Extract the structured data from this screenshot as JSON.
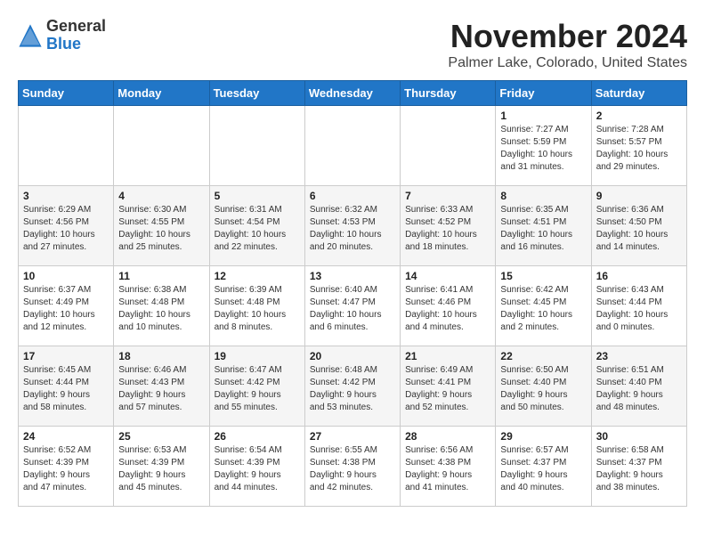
{
  "logo": {
    "general": "General",
    "blue": "Blue"
  },
  "header": {
    "month_title": "November 2024",
    "location": "Palmer Lake, Colorado, United States"
  },
  "days_of_week": [
    "Sunday",
    "Monday",
    "Tuesday",
    "Wednesday",
    "Thursday",
    "Friday",
    "Saturday"
  ],
  "weeks": [
    [
      {
        "day": "",
        "info": ""
      },
      {
        "day": "",
        "info": ""
      },
      {
        "day": "",
        "info": ""
      },
      {
        "day": "",
        "info": ""
      },
      {
        "day": "",
        "info": ""
      },
      {
        "day": "1",
        "info": "Sunrise: 7:27 AM\nSunset: 5:59 PM\nDaylight: 10 hours\nand 31 minutes."
      },
      {
        "day": "2",
        "info": "Sunrise: 7:28 AM\nSunset: 5:57 PM\nDaylight: 10 hours\nand 29 minutes."
      }
    ],
    [
      {
        "day": "3",
        "info": "Sunrise: 6:29 AM\nSunset: 4:56 PM\nDaylight: 10 hours\nand 27 minutes."
      },
      {
        "day": "4",
        "info": "Sunrise: 6:30 AM\nSunset: 4:55 PM\nDaylight: 10 hours\nand 25 minutes."
      },
      {
        "day": "5",
        "info": "Sunrise: 6:31 AM\nSunset: 4:54 PM\nDaylight: 10 hours\nand 22 minutes."
      },
      {
        "day": "6",
        "info": "Sunrise: 6:32 AM\nSunset: 4:53 PM\nDaylight: 10 hours\nand 20 minutes."
      },
      {
        "day": "7",
        "info": "Sunrise: 6:33 AM\nSunset: 4:52 PM\nDaylight: 10 hours\nand 18 minutes."
      },
      {
        "day": "8",
        "info": "Sunrise: 6:35 AM\nSunset: 4:51 PM\nDaylight: 10 hours\nand 16 minutes."
      },
      {
        "day": "9",
        "info": "Sunrise: 6:36 AM\nSunset: 4:50 PM\nDaylight: 10 hours\nand 14 minutes."
      }
    ],
    [
      {
        "day": "10",
        "info": "Sunrise: 6:37 AM\nSunset: 4:49 PM\nDaylight: 10 hours\nand 12 minutes."
      },
      {
        "day": "11",
        "info": "Sunrise: 6:38 AM\nSunset: 4:48 PM\nDaylight: 10 hours\nand 10 minutes."
      },
      {
        "day": "12",
        "info": "Sunrise: 6:39 AM\nSunset: 4:48 PM\nDaylight: 10 hours\nand 8 minutes."
      },
      {
        "day": "13",
        "info": "Sunrise: 6:40 AM\nSunset: 4:47 PM\nDaylight: 10 hours\nand 6 minutes."
      },
      {
        "day": "14",
        "info": "Sunrise: 6:41 AM\nSunset: 4:46 PM\nDaylight: 10 hours\nand 4 minutes."
      },
      {
        "day": "15",
        "info": "Sunrise: 6:42 AM\nSunset: 4:45 PM\nDaylight: 10 hours\nand 2 minutes."
      },
      {
        "day": "16",
        "info": "Sunrise: 6:43 AM\nSunset: 4:44 PM\nDaylight: 10 hours\nand 0 minutes."
      }
    ],
    [
      {
        "day": "17",
        "info": "Sunrise: 6:45 AM\nSunset: 4:44 PM\nDaylight: 9 hours\nand 58 minutes."
      },
      {
        "day": "18",
        "info": "Sunrise: 6:46 AM\nSunset: 4:43 PM\nDaylight: 9 hours\nand 57 minutes."
      },
      {
        "day": "19",
        "info": "Sunrise: 6:47 AM\nSunset: 4:42 PM\nDaylight: 9 hours\nand 55 minutes."
      },
      {
        "day": "20",
        "info": "Sunrise: 6:48 AM\nSunset: 4:42 PM\nDaylight: 9 hours\nand 53 minutes."
      },
      {
        "day": "21",
        "info": "Sunrise: 6:49 AM\nSunset: 4:41 PM\nDaylight: 9 hours\nand 52 minutes."
      },
      {
        "day": "22",
        "info": "Sunrise: 6:50 AM\nSunset: 4:40 PM\nDaylight: 9 hours\nand 50 minutes."
      },
      {
        "day": "23",
        "info": "Sunrise: 6:51 AM\nSunset: 4:40 PM\nDaylight: 9 hours\nand 48 minutes."
      }
    ],
    [
      {
        "day": "24",
        "info": "Sunrise: 6:52 AM\nSunset: 4:39 PM\nDaylight: 9 hours\nand 47 minutes."
      },
      {
        "day": "25",
        "info": "Sunrise: 6:53 AM\nSunset: 4:39 PM\nDaylight: 9 hours\nand 45 minutes."
      },
      {
        "day": "26",
        "info": "Sunrise: 6:54 AM\nSunset: 4:39 PM\nDaylight: 9 hours\nand 44 minutes."
      },
      {
        "day": "27",
        "info": "Sunrise: 6:55 AM\nSunset: 4:38 PM\nDaylight: 9 hours\nand 42 minutes."
      },
      {
        "day": "28",
        "info": "Sunrise: 6:56 AM\nSunset: 4:38 PM\nDaylight: 9 hours\nand 41 minutes."
      },
      {
        "day": "29",
        "info": "Sunrise: 6:57 AM\nSunset: 4:37 PM\nDaylight: 9 hours\nand 40 minutes."
      },
      {
        "day": "30",
        "info": "Sunrise: 6:58 AM\nSunset: 4:37 PM\nDaylight: 9 hours\nand 38 minutes."
      }
    ]
  ]
}
